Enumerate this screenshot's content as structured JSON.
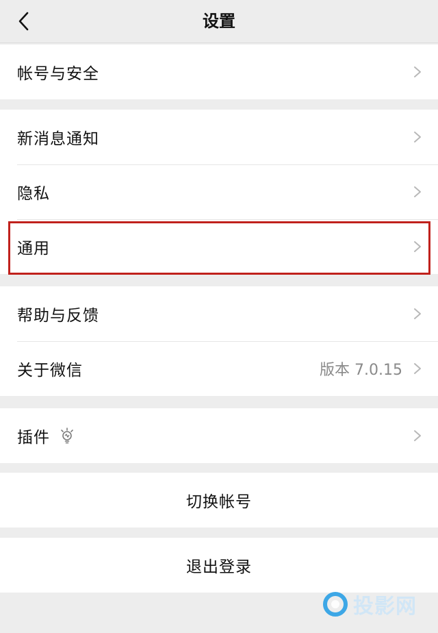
{
  "nav": {
    "title": "设置",
    "back_icon": "chevron-left-icon"
  },
  "groups": [
    {
      "items": [
        {
          "label": "帐号与安全"
        }
      ]
    },
    {
      "items": [
        {
          "label": "新消息通知"
        },
        {
          "label": "隐私"
        },
        {
          "label": "通用"
        }
      ]
    },
    {
      "items": [
        {
          "label": "帮助与反馈"
        },
        {
          "label": "关于微信",
          "value": "版本 7.0.15"
        }
      ]
    },
    {
      "items": [
        {
          "label": "插件",
          "icon": "lightbulb-icon"
        }
      ]
    }
  ],
  "actions": {
    "switch_account": "切换帐号",
    "logout": "退出登录"
  },
  "highlight": {
    "target": "通用",
    "color": "#c0211c"
  },
  "watermark": {
    "text": "投影网",
    "icon": "circle-logo-icon"
  },
  "colors": {
    "background": "#ededed",
    "surface": "#ffffff",
    "divider": "#e6e6e6",
    "chevron": "#b8b8b8",
    "secondary_text": "#8a8a8a"
  }
}
